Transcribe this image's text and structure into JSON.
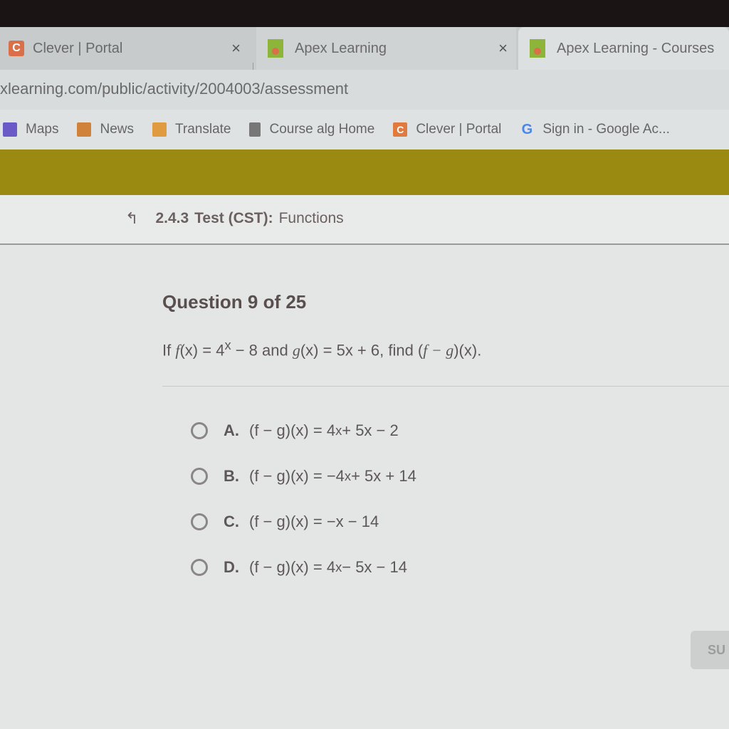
{
  "browser": {
    "tabs": [
      {
        "title": "Clever | Portal",
        "favicon": "clever-icon",
        "active": false
      },
      {
        "title": "Apex Learning",
        "favicon": "apex-icon",
        "active": false
      },
      {
        "title": "Apex Learning - Courses",
        "favicon": "apex-icon",
        "active": true
      }
    ],
    "close_glyph": "×",
    "url": "xlearning.com/public/activity/2004003/assessment",
    "bookmarks": [
      {
        "label": "Maps",
        "icon": "maps-icon"
      },
      {
        "label": "News",
        "icon": "news-icon"
      },
      {
        "label": "Translate",
        "icon": "translate-icon"
      },
      {
        "label": "Course alg Home",
        "icon": "book-icon"
      },
      {
        "label": "Clever | Portal",
        "icon": "clever-icon",
        "glyph": "C"
      },
      {
        "label": "Sign in - Google Ac...",
        "icon": "google-icon",
        "glyph": "G"
      }
    ]
  },
  "breadcrumb": {
    "up_glyph": "↰",
    "number": "2.4.3",
    "type": "Test (CST):",
    "title": "Functions"
  },
  "question": {
    "heading": "Question 9 of 25",
    "prompt_prefix": "If ",
    "prompt_f": "f",
    "prompt_mid1": "(x) = 4",
    "prompt_exp": "x",
    "prompt_mid2": " − 8 and ",
    "prompt_g": "g",
    "prompt_mid3": "(x) = 5x + 6, find (",
    "prompt_fg": "f − g",
    "prompt_end": ")(x).",
    "options": [
      {
        "letter": "A.",
        "lhs": "(f − g)(x) = ",
        "rhs_a": "4",
        "exp": "x",
        "rhs_b": " + 5x − 2"
      },
      {
        "letter": "B.",
        "lhs": "(f − g)(x) = ",
        "rhs_a": "−4",
        "exp": "x",
        "rhs_b": " + 5x + 14"
      },
      {
        "letter": "C.",
        "lhs": "(f − g)(x) = ",
        "rhs_a": "−x − 14",
        "exp": "",
        "rhs_b": ""
      },
      {
        "letter": "D.",
        "lhs": "(f − g)(x) = ",
        "rhs_a": "4",
        "exp": "x",
        "rhs_b": " − 5x − 14"
      }
    ]
  },
  "submit_label": "SU",
  "colors": {
    "apex_bar": "#9b8a12",
    "clever": "#e07a3e",
    "apex_green": "#8cb53a"
  }
}
